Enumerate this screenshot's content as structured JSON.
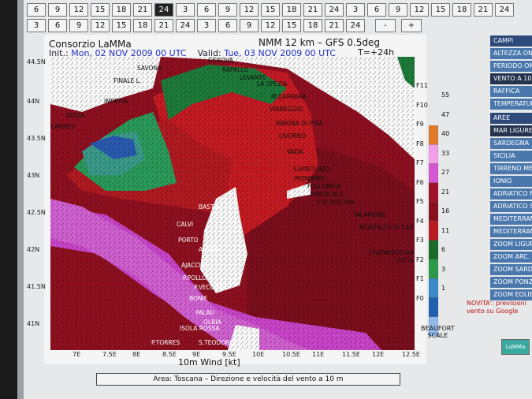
{
  "hour_rows": [
    [
      "6",
      "9",
      "12",
      "15",
      "18",
      "21",
      "24",
      "3",
      "6",
      "9",
      "12",
      "15",
      "18",
      "21",
      "24",
      "3",
      "6",
      "9",
      "12",
      "15",
      "18",
      "21",
      "24"
    ],
    [
      "3",
      "6",
      "9",
      "12",
      "15",
      "18",
      "21",
      "24",
      "3",
      "6",
      "9",
      "12",
      "15",
      "18",
      "21",
      "24",
      "-",
      "+"
    ]
  ],
  "active_hour": "24",
  "map": {
    "org": "Consorzio LaMMa",
    "title": "NMM 12 km – GFS 0.5deg",
    "init_label": "Init.:",
    "init_value": "Mon, 02 NOV 2009   00 UTC",
    "valid_label": "Valid:",
    "valid_value": "Tue, 03 NOV 2009   00 UTC",
    "t_offset": "T=+24h",
    "xlabel": "10m Wind [kt]",
    "beaufort": "BEAUFORT SCALE"
  },
  "lat_labels": [
    "44.5N",
    "44N",
    "43.5N",
    "43N",
    "42.5N",
    "42N",
    "41.5N",
    "41N"
  ],
  "lon_labels": [
    "7E",
    "7.5E",
    "8E",
    "8.5E",
    "9E",
    "9.5E",
    "10E",
    "10.5E",
    "11E",
    "11.5E",
    "12E",
    "12.5E"
  ],
  "f_scale": [
    "F11",
    "F10",
    "F9",
    "F8",
    "F7",
    "F6",
    "F5",
    "F4",
    "F3",
    "F2",
    "F1",
    "F0"
  ],
  "kt_scale": [
    "55",
    "47",
    "40",
    "33",
    "27",
    "21",
    "16",
    "11",
    "6",
    "3",
    "1"
  ],
  "colors": [
    "#e07a2a",
    "#f2a0e8",
    "#d458d4",
    "#a01028",
    "#8a1020",
    "#b81a22",
    "#1a6a2a",
    "#2a9a4a",
    "#3a8ac8",
    "#2060b0",
    "#90b8e8"
  ],
  "cities": [
    {
      "name": "SAVONA"
    },
    {
      "name": "GENOVA"
    },
    {
      "name": "RAPALLO"
    },
    {
      "name": "LEVANTE"
    },
    {
      "name": "LA SPEZIA"
    },
    {
      "name": "FINALE L."
    },
    {
      "name": "M.CARRARA"
    },
    {
      "name": "IMPERIA"
    },
    {
      "name": "VIAREGGIO"
    },
    {
      "name": "NIZZA"
    },
    {
      "name": "MARINA DI PISA"
    },
    {
      "name": "CANNES"
    },
    {
      "name": "LIVORNO"
    },
    {
      "name": "VADA"
    },
    {
      "name": "S.VINCENZO"
    },
    {
      "name": "PIOMBINO"
    },
    {
      "name": "FOLLONICA"
    },
    {
      "name": "PUNTA ALA"
    },
    {
      "name": "C.D.PESCAIA"
    },
    {
      "name": "BASTIA"
    },
    {
      "name": "TALAMONE"
    },
    {
      "name": "CALVI"
    },
    {
      "name": "MONTALTO DI CASTRO"
    },
    {
      "name": "PORTO"
    },
    {
      "name": "ALERIA"
    },
    {
      "name": "CIVITAVECCHIA"
    },
    {
      "name": "AJACCIO"
    },
    {
      "name": "OSTIA LIDO"
    },
    {
      "name": "P.POLLO"
    },
    {
      "name": "P.VECCHIO"
    },
    {
      "name": "BONIF."
    },
    {
      "name": "PALAU"
    },
    {
      "name": "OLBIA"
    },
    {
      "name": "ISOLA ROSSA"
    },
    {
      "name": "P.TORRES"
    },
    {
      "name": "S.TEODORO"
    }
  ],
  "caption": "Area: Toscana – Direzione e velocità del vento a 10 m",
  "sidebar": {
    "campi_header": "CAMPI",
    "campi": [
      "ALTEZZA ONDE",
      "PERIODO ONDE",
      "VENTO A 10 M",
      "RAFFICA",
      "TEMPERATURA"
    ],
    "campi_active": "VENTO A 10 M",
    "aree_header": "AREE",
    "aree": [
      "MAR LIGURE",
      "SARDEGNA",
      "SICILIA",
      "TIRRENO MERIDIONALE",
      "IONIO",
      "ADRIATICO NORD",
      "ADRIATICO SUD",
      "MEDITERRANEO",
      "MEDITERRANEO EST",
      "ZOOM LIGURE",
      "ZOOM ARC. TOSCANO",
      "ZOOM SARDEGNA",
      "ZOOM PONZA",
      "ZOOM EOLIE"
    ],
    "aree_active": "MAR LIGURE",
    "news_line1": "NOVITA': previsioni",
    "news_line2": "vento su Google",
    "logo": "LaMMa"
  }
}
